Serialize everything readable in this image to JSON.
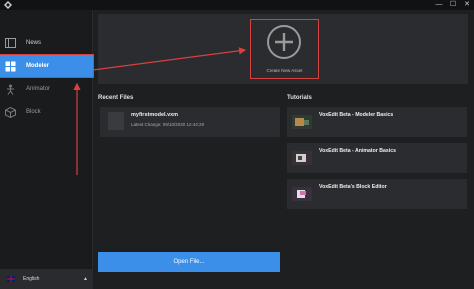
{
  "window": {
    "minimize_glyph": "—",
    "maximize_glyph": "☐",
    "close_glyph": "✕"
  },
  "sidebar": {
    "items": [
      {
        "label": "News",
        "icon": "news-icon"
      },
      {
        "label": "Modeler",
        "icon": "modeler-icon",
        "active": true
      },
      {
        "label": "Animator",
        "icon": "animator-icon"
      },
      {
        "label": "Block",
        "icon": "block-icon"
      }
    ],
    "language": {
      "label": "English",
      "icon": "uk-flag-icon",
      "caret": "▲"
    }
  },
  "create": {
    "label": "Create New Asset",
    "icon": "plus-circle-icon"
  },
  "recent": {
    "title": "Recent Files",
    "items": [
      {
        "name": "myfirstmodel.vxm",
        "date": "Latest Change: 09/10/2020 12:44:29"
      }
    ]
  },
  "tutorials": {
    "title": "Tutorials",
    "items": [
      {
        "title": "VoxEdit Beta - Modeler Basics"
      },
      {
        "title": "VoxEdit Beta - Animator Basics"
      },
      {
        "title": "VoxEdit Beta's Block Editor"
      }
    ]
  },
  "open_file": {
    "label": "Open File..."
  },
  "colors": {
    "accent": "#3c8fe8",
    "annotation_red": "#d94040",
    "panel": "#2b2c2f",
    "background": "#1e1f21"
  }
}
